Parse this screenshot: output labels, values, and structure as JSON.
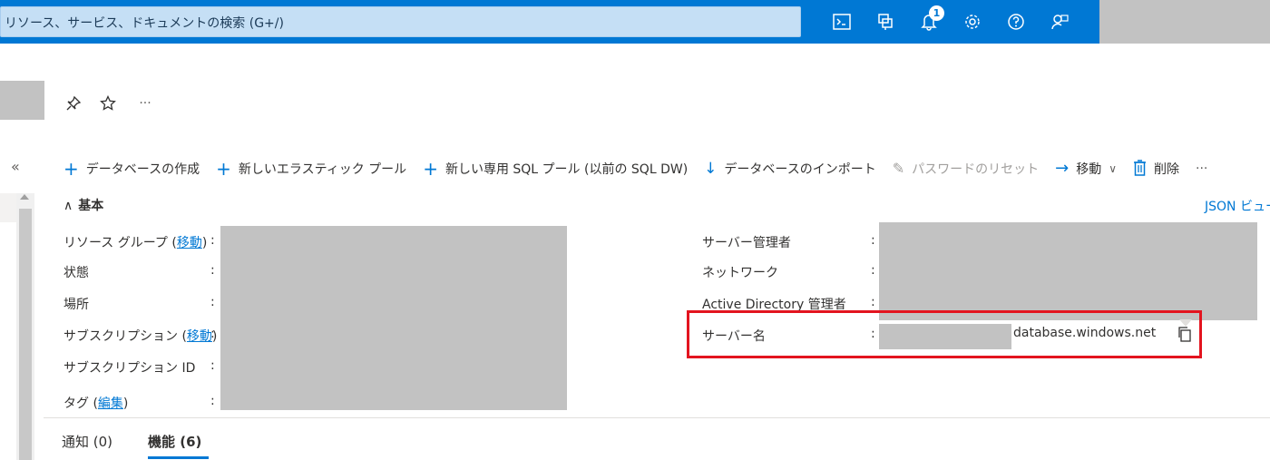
{
  "topbar": {
    "search_placeholder": "リソース、サービス、ドキュメントの検索 (G+/)",
    "notification_count": "1",
    "brand_color": "#0078d4",
    "icons": [
      "cloud-shell-icon",
      "directory-filter-icon",
      "notification-icon",
      "settings-icon",
      "help-icon",
      "feedback-icon"
    ]
  },
  "title_actions": {
    "pin": "pin-icon",
    "favorite": "star-icon",
    "more": "···"
  },
  "command_bar": {
    "create_db": "データベースの作成",
    "new_elastic_pool": "新しいエラスティック プール",
    "new_sql_pool": "新しい専用 SQL プール (以前の SQL DW)",
    "import_db": "データベースのインポート",
    "reset_password": "パスワードのリセット",
    "move": "移動",
    "delete": "削除",
    "more": "···"
  },
  "essentials": {
    "header": "基本",
    "json_view": "JSON ビュー",
    "left": {
      "resource_group_label": "リソース グループ",
      "resource_group_link": "移動",
      "status_label": "状態",
      "location_label": "場所",
      "subscription_label": "サブスクリプション",
      "subscription_link": "移動",
      "subscription_id_label": "サブスクリプション ID",
      "tags_label": "タグ",
      "tags_link": "編集"
    },
    "right": {
      "server_admin_label": "サーバー管理者",
      "network_label": "ネットワーク",
      "ad_admin_label": "Active Directory 管理者",
      "server_name_label": "サーバー名",
      "server_name_suffix": "database.windows.net"
    },
    "colon": ":"
  },
  "tabs": {
    "notifications": "通知 (0)",
    "features": "機能 (6)"
  }
}
